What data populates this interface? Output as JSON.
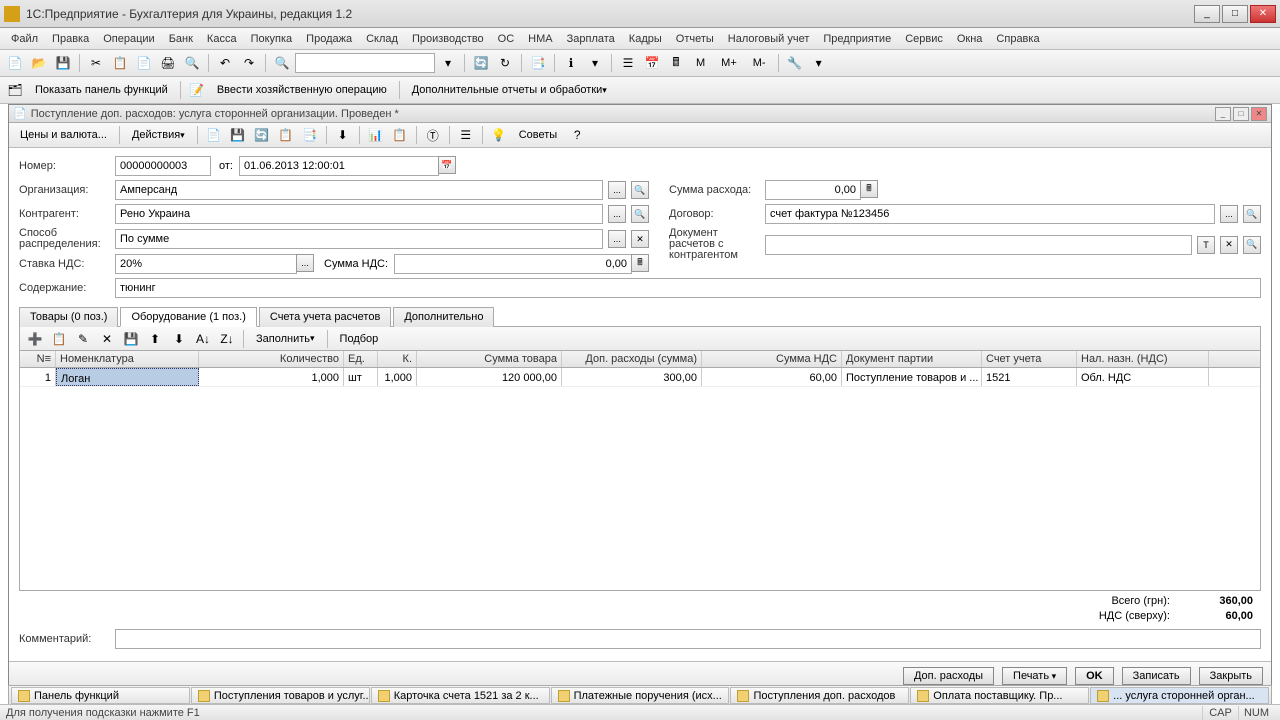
{
  "window_title": "1С:Предприятие - Бухгалтерия для Украины, редакция 1.2",
  "menu": [
    "Файл",
    "Правка",
    "Операции",
    "Банк",
    "Касса",
    "Покупка",
    "Продажа",
    "Склад",
    "Производство",
    "ОС",
    "НМА",
    "Зарплата",
    "Кадры",
    "Отчеты",
    "Налоговый учет",
    "Предприятие",
    "Сервис",
    "Окна",
    "Справка"
  ],
  "toolbar2": {
    "show_panel": "Показать панель функций",
    "manual_op": "Ввести хозяйственную операцию",
    "extra": "Дополнительные отчеты и обработки"
  },
  "subwindow": {
    "title": "Поступление доп. расходов: услуга сторонней организации. Проведен *",
    "prices_btn": "Цены и валюта...",
    "actions_btn": "Действия",
    "tips_btn": "Советы"
  },
  "form": {
    "number_lbl": "Номер:",
    "number_val": "00000000003",
    "from_lbl": "от:",
    "date_val": "01.06.2013 12:00:01",
    "org_lbl": "Организация:",
    "org_val": "Амперсанд",
    "counter_lbl": "Контрагент:",
    "counter_val": "Рено Украина",
    "distr_lbl": "Способ распределения:",
    "distr_val": "По сумме",
    "vat_lbl": "Ставка НДС:",
    "vat_val": "20%",
    "vat_sum_lbl": "Сумма НДС:",
    "vat_sum_val": "0,00",
    "content_lbl": "Содержание:",
    "content_val": "тюнинг",
    "expense_lbl": "Сумма расхода:",
    "expense_val": "0,00",
    "contract_lbl": "Договор:",
    "contract_val": "счет фактура №123456",
    "settledoc_lbl": "Документ расчетов с контрагентом",
    "settledoc_val": ""
  },
  "tabs": [
    "Товары (0 поз.)",
    "Оборудование (1 поз.)",
    "Счета учета расчетов",
    "Дополнительно"
  ],
  "grid_toolbar": {
    "fill": "Заполнить",
    "pick": "Подбор"
  },
  "grid": {
    "headers": [
      "N≡",
      "Номенклатура",
      "Количество",
      "Ед.",
      "К.",
      "Сумма товара",
      "Доп. расходы (сумма)",
      "Сумма НДС",
      "Документ партии",
      "Счет учета",
      "Нал. назн. (НДС)"
    ],
    "rows": [
      {
        "n": "1",
        "name": "Логан",
        "qty": "1,000",
        "unit": "шт",
        "k": "1,000",
        "sum": "120 000,00",
        "extra": "300,00",
        "vat": "60,00",
        "doc": "Поступление товаров и ...",
        "acct": "1521",
        "vat_purp": "Обл. НДС"
      }
    ]
  },
  "totals": {
    "total_lbl": "Всего (грн):",
    "total_val": "360,00",
    "vat_lbl": "НДС (сверху):",
    "vat_val": "60,00"
  },
  "comment_lbl": "Комментарий:",
  "comment_val": "",
  "actions": {
    "extra": "Доп. расходы",
    "print": "Печать",
    "ok": "OK",
    "save": "Записать",
    "close": "Закрыть"
  },
  "taskbar": [
    "Панель функций",
    "Поступления товаров и услуг...",
    "Карточка счета 1521 за 2 к...",
    "Платежные поручения (исх...",
    "Поступления доп. расходов",
    "Оплата поставщику. Пр...",
    "... услуга сторонней орган..."
  ],
  "status": {
    "hint": "Для получения подсказки нажмите F1",
    "cap": "CAP",
    "num": "NUM"
  }
}
